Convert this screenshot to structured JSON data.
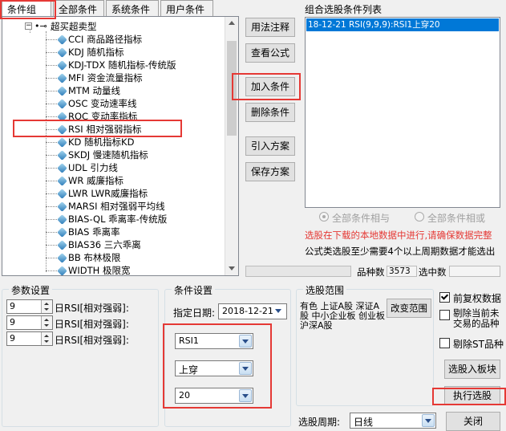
{
  "tabs": [
    "条件组",
    "全部条件",
    "系统条件",
    "用户条件"
  ],
  "tree": {
    "root_label": "超买超卖型",
    "items": [
      "CCI 商品路径指标",
      "KDJ 随机指标",
      "KDJ-TDX 随机指标-传统版",
      "MFI 资金流量指标",
      "MTM 动量线",
      "OSC 变动速率线",
      "ROC 变动率指标",
      "RSI 相对强弱指标",
      "KD 随机指标KD",
      "SKDJ 慢速随机指标",
      "UDL 引力线",
      "WR 威廉指标",
      "LWR LWR威廉指标",
      "MARSI 相对强弱平均线",
      "BIAS-QL 乖离率-传统版",
      "BIAS 乖离率",
      "BIAS36 三六乖离",
      "BB 布林极限",
      "WIDTH 极限宽"
    ]
  },
  "middle_buttons": [
    "用法注释",
    "查看公式",
    "加入条件",
    "删除条件",
    "引入方案",
    "保存方案"
  ],
  "combo": {
    "title": "组合选股条件列表",
    "items": [
      "18-12-21 RSI(9,9,9):RSI1上穿20"
    ],
    "radio_and": "全部条件相与",
    "radio_or": "全部条件相或",
    "warning": "选股在下载的本地数据中进行,请确保数据完整",
    "note": "公式类选股至少需要4个以上周期数据才能选出",
    "count_label": "品种数",
    "count_value": "3573",
    "selected_label": "选中数"
  },
  "params": {
    "title": "参数设置",
    "rows": [
      {
        "value": "9",
        "label": "日RSI[相对强弱]:"
      },
      {
        "value": "9",
        "label": "日RSI[相对强弱]:"
      },
      {
        "value": "9",
        "label": "日RSI[相对强弱]:"
      }
    ]
  },
  "condition": {
    "title": "条件设置",
    "date_label": "指定日期:",
    "date_value": "2018-12-21",
    "line": "RSI1",
    "cross": "上穿",
    "threshold": "20"
  },
  "range": {
    "title": "选股范围",
    "text": "有色 上证A股 深证A股 中小企业板 创业板 沪深A股",
    "change_button": "改变范围"
  },
  "options": {
    "fq": "前复权数据",
    "remove_st_untraded": "剔除当前未交易的品种",
    "remove_st": "剔除ST品种",
    "to_block": "选股入板块",
    "execute": "执行选股",
    "close": "关闭"
  },
  "period": {
    "label": "选股周期:",
    "value": "日线"
  },
  "accent": "#e53935",
  "select_blue": "#0078d7"
}
